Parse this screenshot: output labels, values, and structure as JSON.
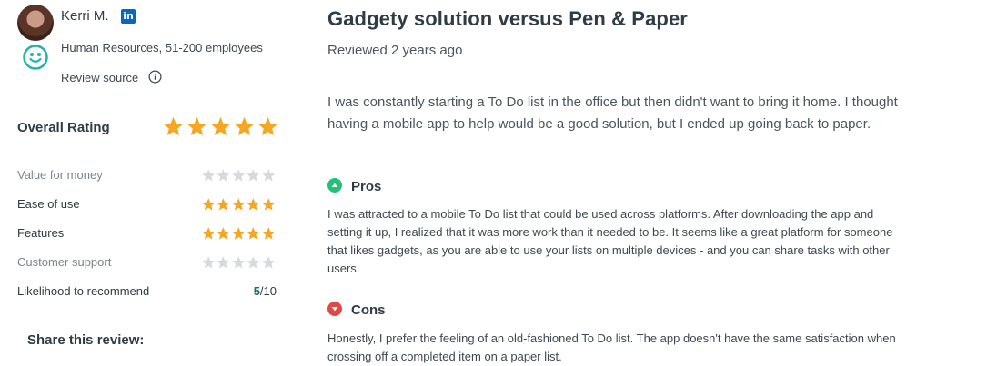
{
  "reviewer": {
    "name": "Kerri M.",
    "linkedin_glyph": "in",
    "meta": "Human Resources, 51-200 employees",
    "source_label": "Review source"
  },
  "ratings": {
    "overall_label": "Overall Rating",
    "overall_stars": 5,
    "items": [
      {
        "label": "Value for money",
        "stars": 0
      },
      {
        "label": "Ease of use",
        "stars": 5
      },
      {
        "label": "Features",
        "stars": 5
      },
      {
        "label": "Customer support",
        "stars": 0
      }
    ],
    "likelihood_label": "Likelihood to recommend",
    "likelihood_score": "5",
    "likelihood_out_of": "/10"
  },
  "share_label": "Share this review:",
  "review": {
    "title": "Gadgety solution versus Pen & Paper",
    "reviewed": "Reviewed 2 years ago",
    "summary": "I was constantly starting a To Do list in the office but then didn't want to bring it home. I thought having a mobile app to help would be a good solution, but I ended up going back to paper.",
    "pros_title": "Pros",
    "pros_text": "I was attracted to a mobile To Do list that could be used across platforms. After downloading the app and setting it up, I realized that it was more work than it needed to be. It seems like a great platform for someone that likes gadgets, as you are able to use your lists on multiple devices - and you can share tasks with other users.",
    "cons_title": "Cons",
    "cons_text": "Honestly, I prefer the feeling of an old-fashioned To Do list. The app doesn't have the same satisfaction when crossing off a completed item on a paper list."
  },
  "colors": {
    "star_filled": "#f5a623",
    "star_empty": "#d6d9dd",
    "pros": "#21c17a",
    "cons": "#e04848",
    "badge": "#1fb5a8"
  },
  "icons": {
    "linkedin": "linkedin-icon",
    "reviewer_badge": "smile-badge-icon",
    "info": "info-icon",
    "pros": "pros-up-icon",
    "cons": "cons-down-icon",
    "star": "star-icon"
  }
}
